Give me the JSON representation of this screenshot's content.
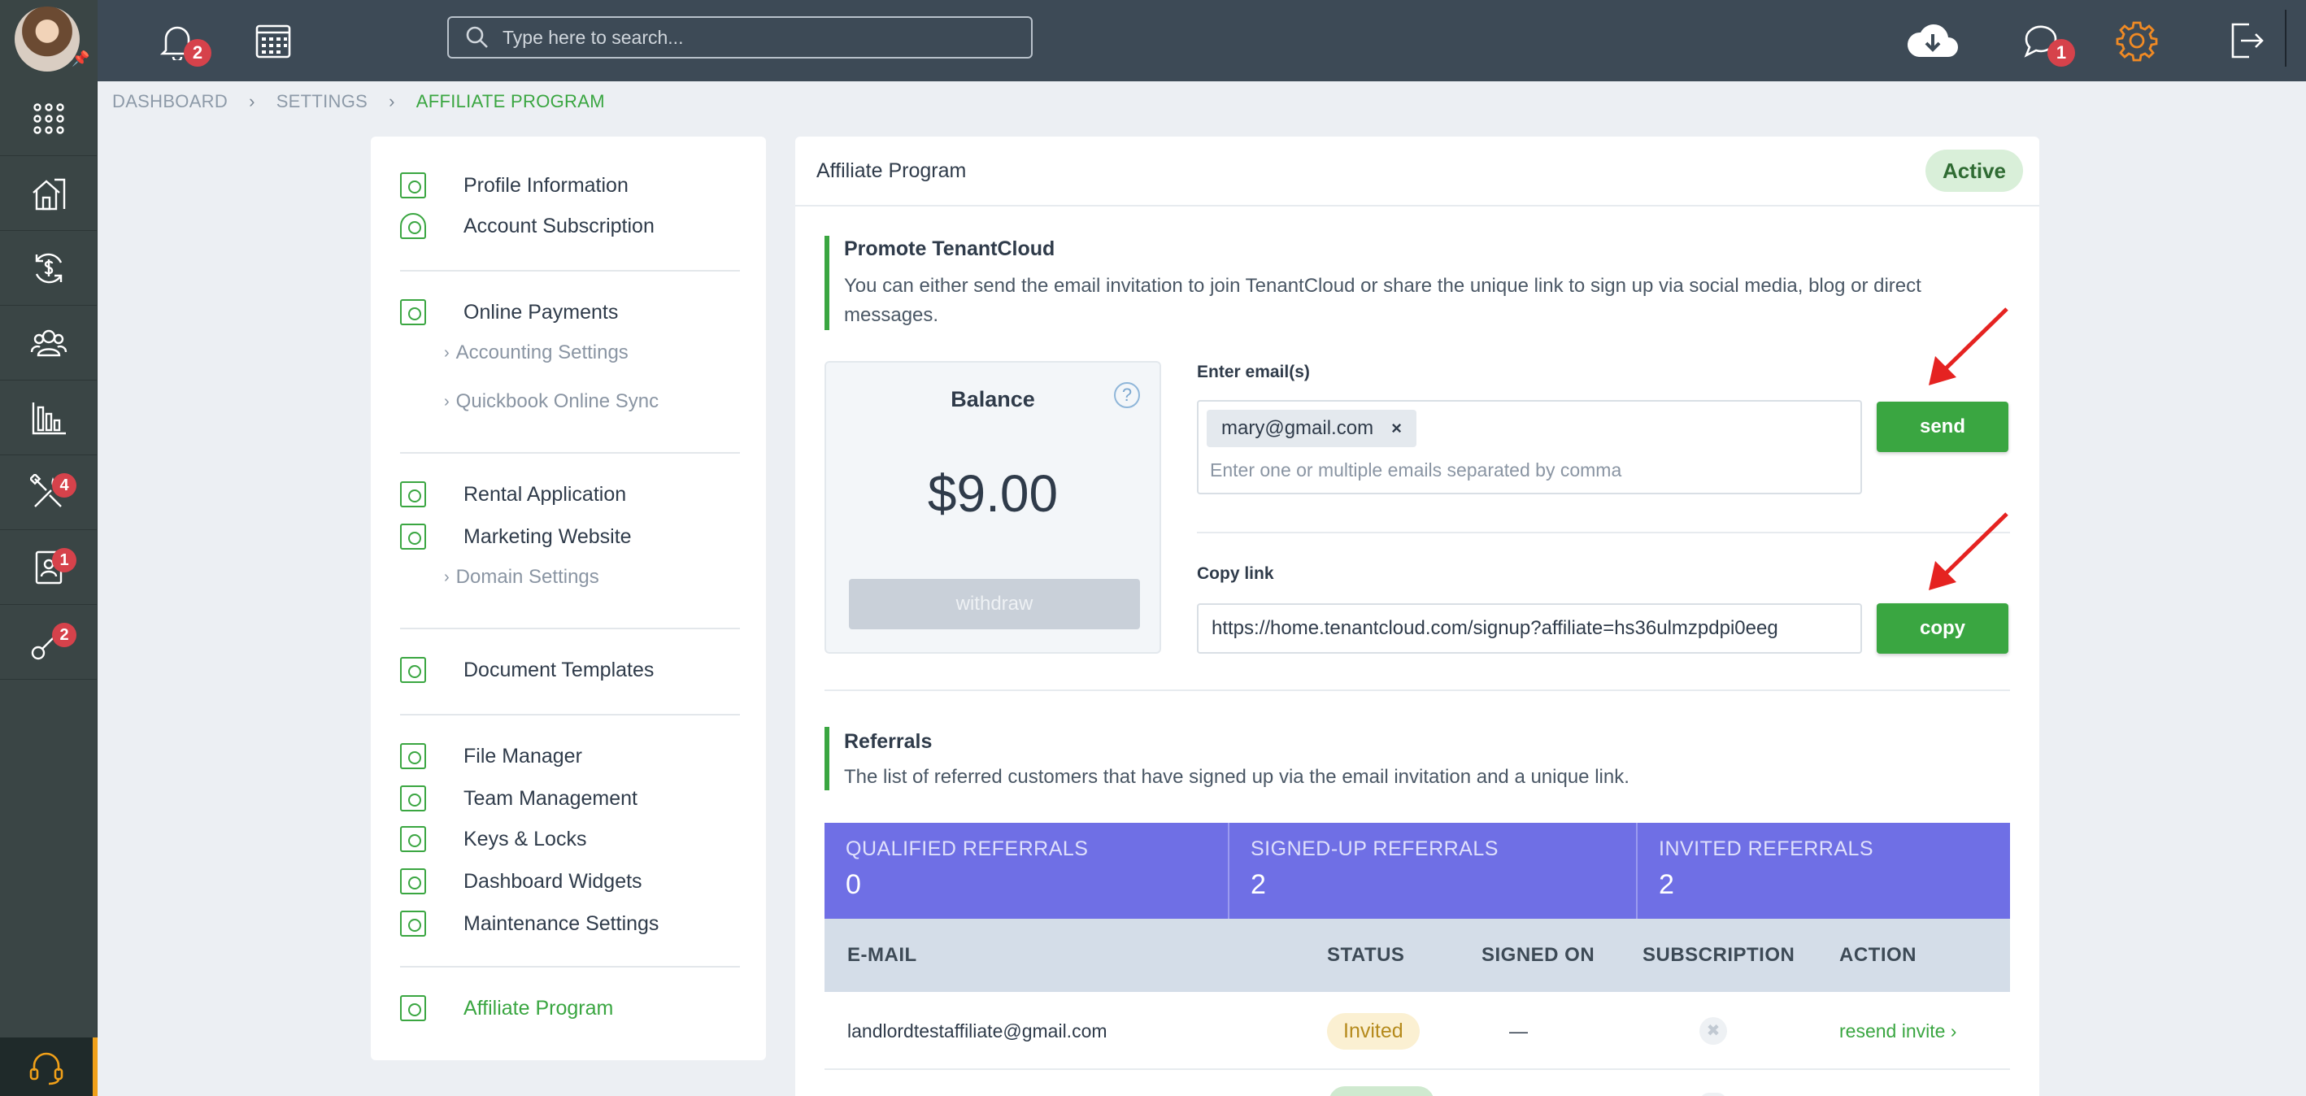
{
  "app": {
    "search_placeholder": "Type here to search...",
    "notifications_count": "2",
    "messages_count": "1"
  },
  "leftnav": {
    "items": [
      {
        "icon": "apps-grid-icon",
        "badge": ""
      },
      {
        "icon": "properties-icon",
        "badge": ""
      },
      {
        "icon": "accounting-icon",
        "badge": ""
      },
      {
        "icon": "contacts-icon",
        "badge": ""
      },
      {
        "icon": "reports-icon",
        "badge": ""
      },
      {
        "icon": "maintenance-icon",
        "badge": "4"
      },
      {
        "icon": "applications-icon",
        "badge": "1"
      },
      {
        "icon": "keys-icon",
        "badge": "2"
      }
    ]
  },
  "breadcrumb": [
    "DASHBOARD",
    "SETTINGS",
    "AFFILIATE PROGRAM"
  ],
  "sidebar": {
    "profile_information": "Profile Information",
    "account_subscription": "Account Subscription",
    "online_payments": "Online Payments",
    "accounting_settings": "Accounting Settings",
    "quickbook_sync": "Quickbook Online Sync",
    "rental_application": "Rental Application",
    "marketing_website": "Marketing Website",
    "domain_settings": "Domain Settings",
    "document_templates": "Document Templates",
    "file_manager": "File Manager",
    "team_management": "Team Management",
    "keys_locks": "Keys & Locks",
    "dashboard_widgets": "Dashboard Widgets",
    "maintenance_settings": "Maintenance Settings",
    "affiliate_program": "Affiliate Program"
  },
  "main": {
    "title": "Affiliate Program",
    "status": "Active",
    "promote_title": "Promote TenantCloud",
    "promote_desc": "You can either send the email invitation to join TenantCloud or share the unique link to sign up via social media, blog or direct messages.",
    "balance_title": "Balance",
    "balance_help": "?",
    "balance_amount": "$9.00",
    "withdraw_label": "withdraw",
    "enter_emails_label": "Enter email(s)",
    "email_chip": "mary@gmail.com",
    "email_chip_remove": "×",
    "email_placeholder": "Enter one or multiple emails separated by comma",
    "send_label": "send",
    "copy_link_label": "Copy link",
    "copy_link_value": "https://home.tenantcloud.com/signup?affiliate=hs36ulmzpdpi0eeg",
    "copy_label": "copy",
    "referrals_title": "Referrals",
    "referrals_desc": "The list of referred customers that have signed up via the email invitation and a unique link.",
    "stats": [
      {
        "label": "QUALIFIED REFERRALS",
        "value": "0"
      },
      {
        "label": "SIGNED-UP REFERRALS",
        "value": "2"
      },
      {
        "label": "INVITED REFERRALS",
        "value": "2"
      }
    ],
    "table_headers": {
      "email": "E-MAIL",
      "status": "STATUS",
      "signed_on": "SIGNED ON",
      "subscription": "SUBSCRIPTION",
      "action": "ACTION"
    },
    "rows": [
      {
        "email": "landlordtestaffiliate@gmail.com",
        "status": "Invited",
        "signed_on": "—",
        "subscription": "✖",
        "action": "resend invite ›"
      }
    ]
  },
  "colors": {
    "accent_green": "#3aa641",
    "stats_purple": "#6f6fe5",
    "topbar": "#3d4a56",
    "leftnav": "#3a4545",
    "badge_red": "#d6424b",
    "arrow_red": "#e52321",
    "settings_orange": "#f08a24"
  }
}
